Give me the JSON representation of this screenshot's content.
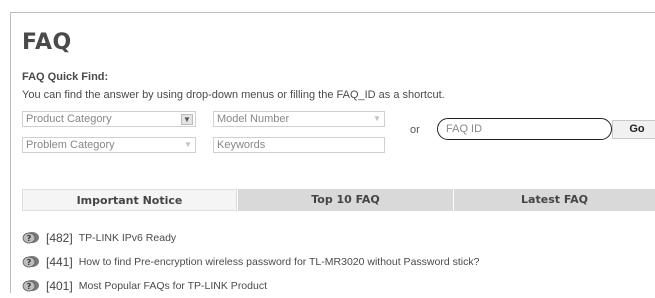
{
  "page": {
    "title": "FAQ",
    "quick_find_label": "FAQ Quick Find:",
    "description": "You can find the answer by using drop-down menus or filling the FAQ_ID as a shortcut."
  },
  "filters": {
    "product_category": "Product Category",
    "model_number": "Model Number",
    "problem_category": "Problem Category",
    "keywords_placeholder": "Keywords",
    "or_label": "or",
    "faq_id_placeholder": "FAQ ID",
    "go_label": "Go"
  },
  "tabs": [
    {
      "label": "Important Notice"
    },
    {
      "label": "Top 10 FAQ"
    },
    {
      "label": "Latest FAQ"
    }
  ],
  "faqs": [
    {
      "id": "[482]",
      "title": "TP-LINK IPv6 Ready"
    },
    {
      "id": "[441]",
      "title": "How to find Pre-encryption wireless password for TL-MR3020 without Password stick?"
    },
    {
      "id": "[401]",
      "title": "Most Popular FAQs for TP-LINK Product"
    }
  ],
  "icons": {
    "faq_item_icon": "question-bubble-icon",
    "dropdown_icon": "chevron-down-icon"
  }
}
